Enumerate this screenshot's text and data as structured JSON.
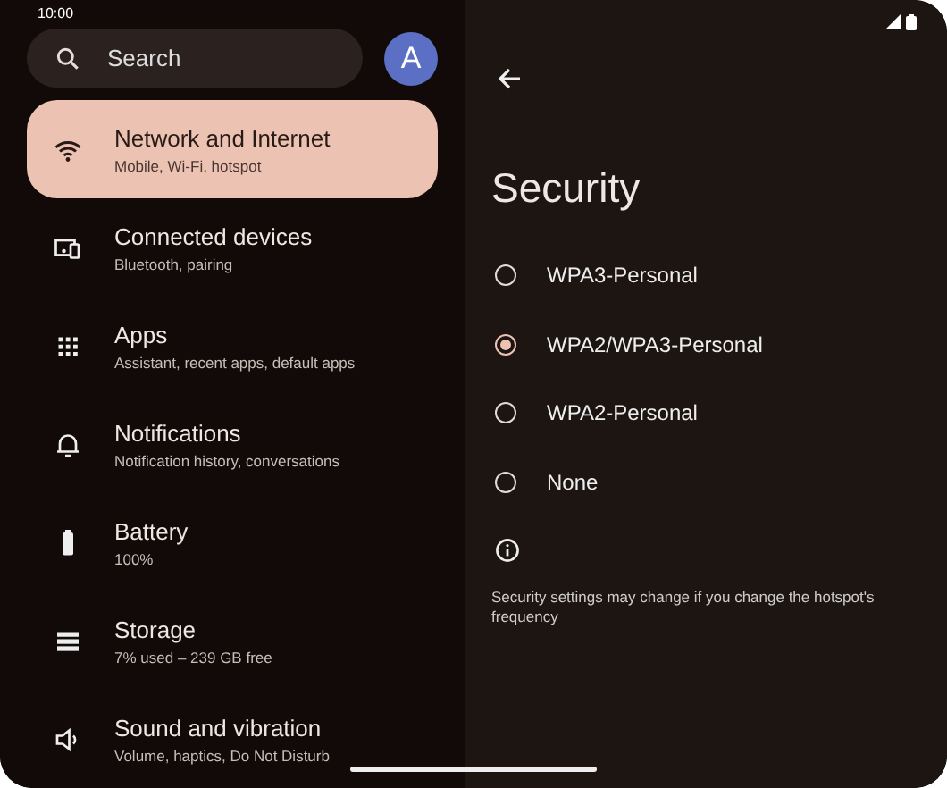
{
  "status_bar": {
    "time": "10:00"
  },
  "search": {
    "placeholder": "Search"
  },
  "avatar": {
    "letter": "A"
  },
  "menu": [
    {
      "kind": "wifi",
      "title": "Network and Internet",
      "subtitle": "Mobile, Wi-Fi, hotspot",
      "selected": true
    },
    {
      "kind": "devices",
      "title": "Connected devices",
      "subtitle": "Bluetooth, pairing",
      "selected": false
    },
    {
      "kind": "apps",
      "title": "Apps",
      "subtitle": "Assistant, recent apps, default apps",
      "selected": false
    },
    {
      "kind": "bell",
      "title": "Notifications",
      "subtitle": "Notification history, conversations",
      "selected": false
    },
    {
      "kind": "battery",
      "title": "Battery",
      "subtitle": "100%",
      "selected": false
    },
    {
      "kind": "storage",
      "title": "Storage",
      "subtitle": "7% used – 239 GB free",
      "selected": false
    },
    {
      "kind": "sound",
      "title": "Sound and vibration",
      "subtitle": "Volume, haptics, Do Not Disturb",
      "selected": false
    }
  ],
  "detail": {
    "title": "Security",
    "options": [
      {
        "label": "WPA3-Personal",
        "selected": false
      },
      {
        "label": "WPA2/WPA3-Personal",
        "selected": true
      },
      {
        "label": "WPA2-Personal",
        "selected": false
      },
      {
        "label": "None",
        "selected": false
      }
    ],
    "note": "Security settings may change if you change the hotspot's frequency"
  }
}
